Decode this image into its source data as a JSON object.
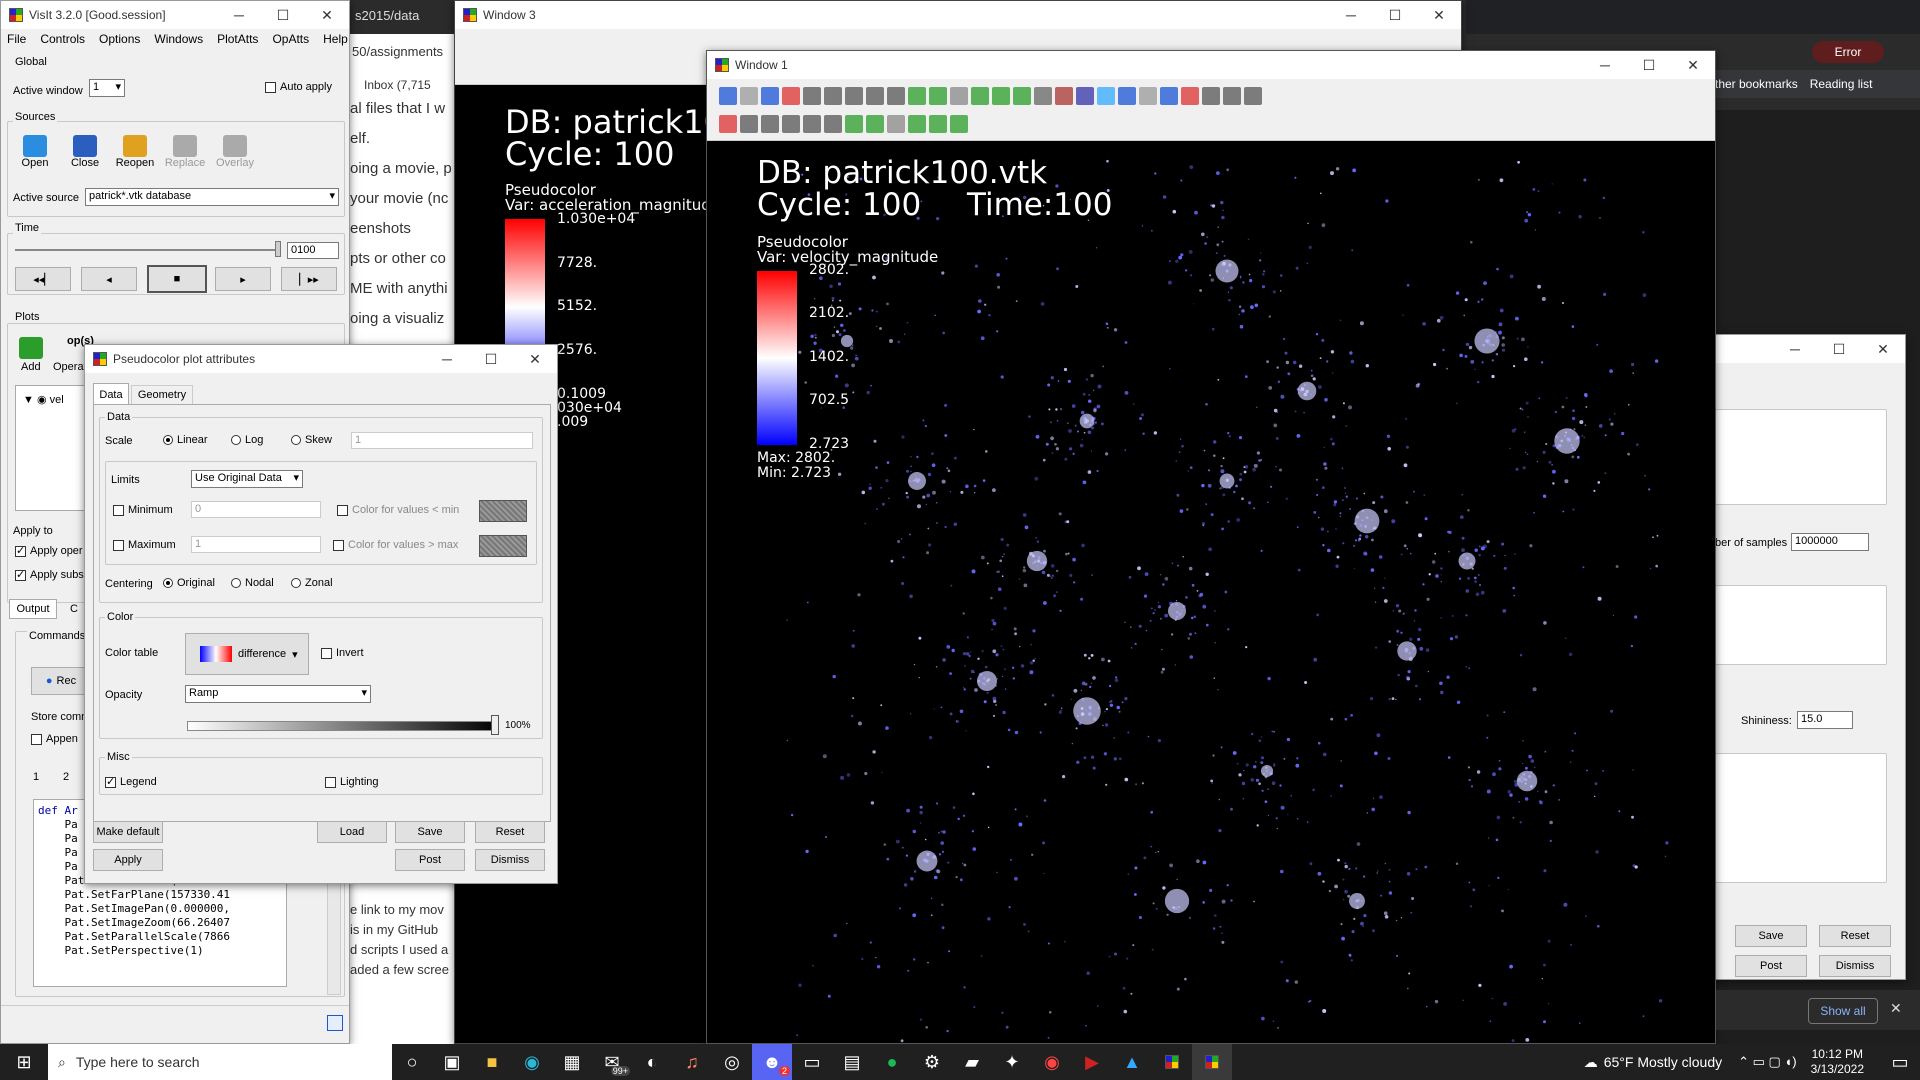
{
  "visit_main": {
    "title": "VisIt 3.2.0 [Good.session]",
    "menu": [
      "File",
      "Controls",
      "Options",
      "Windows",
      "PlotAtts",
      "OpAtts",
      "Help"
    ],
    "global_label": "Global",
    "active_window_label": "Active window",
    "active_window_value": "1",
    "auto_apply_label": "Auto apply",
    "sources_label": "Sources",
    "source_buttons": [
      "Open",
      "Close",
      "Reopen",
      "Replace",
      "Overlay"
    ],
    "active_source_label": "Active source",
    "active_source_value": "patrick*.vtk database",
    "time_label": "Time",
    "time_value": "0100",
    "plots_label": "Plots",
    "plot_buttons": [
      "Add",
      "Operators"
    ],
    "op_label": "op(s)",
    "plot_item": "vel",
    "apply_to_label": "Apply to",
    "apply_ops_label": "Apply oper",
    "apply_subs_label": "Apply subs",
    "tabs": [
      "Output",
      "C"
    ],
    "commands_label": "Commands",
    "record_label": "Rec",
    "store_label": "Store comm",
    "append_label": "Appen",
    "code_tabs": [
      "1",
      "2"
    ],
    "code_lines": [
      "def Ar",
      "    Pa",
      "    Pa",
      "    Pa",
      "    Pa",
      "    Pat.SetNearPlane(-157330.",
      "    Pat.SetFarPlane(157330.41",
      "    Pat.SetImagePan(0.000000,",
      "    Pat.SetImageZoom(66.26407",
      "    Pat.SetParallelScale(7866",
      "    Pat.SetPerspective(1)"
    ]
  },
  "browser_bg": {
    "tab_text": "s2015/data",
    "path_text": "50/assignments",
    "inbox_label": "Inbox (7,715",
    "bookmarks": "ther bookmarks",
    "reading_list": "Reading list",
    "error_label": "Error",
    "page_lines": [
      "al files that I w",
      "elf.",
      "oing a movie, p",
      "your movie (nc",
      "eenshots",
      "pts or other co",
      "ME with anythi",
      "oing a visualiz"
    ],
    "page_lines_bottom": [
      "e link to my mov",
      " is in my GitHub",
      "d scripts I used a",
      "aded a few scree"
    ]
  },
  "window3": {
    "title": "Window 3",
    "db": "DB: patrick10",
    "cycle": "Cycle: 100",
    "plot_type": "Pseudocolor",
    "var": "Var: acceleration_magnitude",
    "ticks": [
      "1.030e+04",
      "7728.",
      "5152.",
      "2576.",
      "0.1009"
    ],
    "max": "030e+04",
    "min": ".009"
  },
  "window1": {
    "title": "Window 1",
    "db": "DB: patrick100.vtk",
    "cycle": "Cycle: 100",
    "time": "Time:100",
    "plot_type": "Pseudocolor",
    "var": "Var: velocity_magnitude",
    "ticks": [
      "2802.",
      "2102.",
      "1402.",
      "702.5",
      "2.723"
    ],
    "max": "Max:  2802.",
    "min": "Min:  2.723"
  },
  "pc_dialog": {
    "title": "Pseudocolor plot attributes",
    "tabs": [
      "Data",
      "Geometry"
    ],
    "data_group": "Data",
    "scale_label": "Scale",
    "scale_options": [
      "Linear",
      "Log",
      "Skew"
    ],
    "skew_value": "1",
    "limits_label": "Limits",
    "limits_value": "Use Original Data",
    "minimum_label": "Minimum",
    "minimum_value": "0",
    "maximum_label": "Maximum",
    "maximum_value": "1",
    "color_min_label": "Color for values < min",
    "color_max_label": "Color for values > max",
    "centering_label": "Centering",
    "centering_options": [
      "Original",
      "Nodal",
      "Zonal"
    ],
    "color_group": "Color",
    "color_table_label": "Color table",
    "color_table_value": "difference",
    "invert_label": "Invert",
    "opacity_label": "Opacity",
    "opacity_value": "Ramp",
    "opacity_pct": "100%",
    "misc_group": "Misc",
    "legend_label": "Legend",
    "lighting_label": "Lighting",
    "buttons": {
      "make_default": "Make default",
      "load": "Load",
      "save": "Save",
      "reset": "Reset",
      "apply": "Apply",
      "post": "Post",
      "dismiss": "Dismiss"
    }
  },
  "right_dialog": {
    "samples_label": "ber of samples",
    "samples_value": "1000000",
    "shininess_label": "Shininess:",
    "shininess_value": "15.0",
    "save": "Save",
    "reset": "Reset",
    "post": "Post",
    "dismiss": "Dismiss"
  },
  "show_all": "Show all",
  "taskbar": {
    "search_placeholder": "Type here to search",
    "weather": "65°F  Mostly cloudy",
    "time": "10:12 PM",
    "date": "3/13/2022",
    "mail_badge": "99+",
    "discord_badge": "2"
  }
}
